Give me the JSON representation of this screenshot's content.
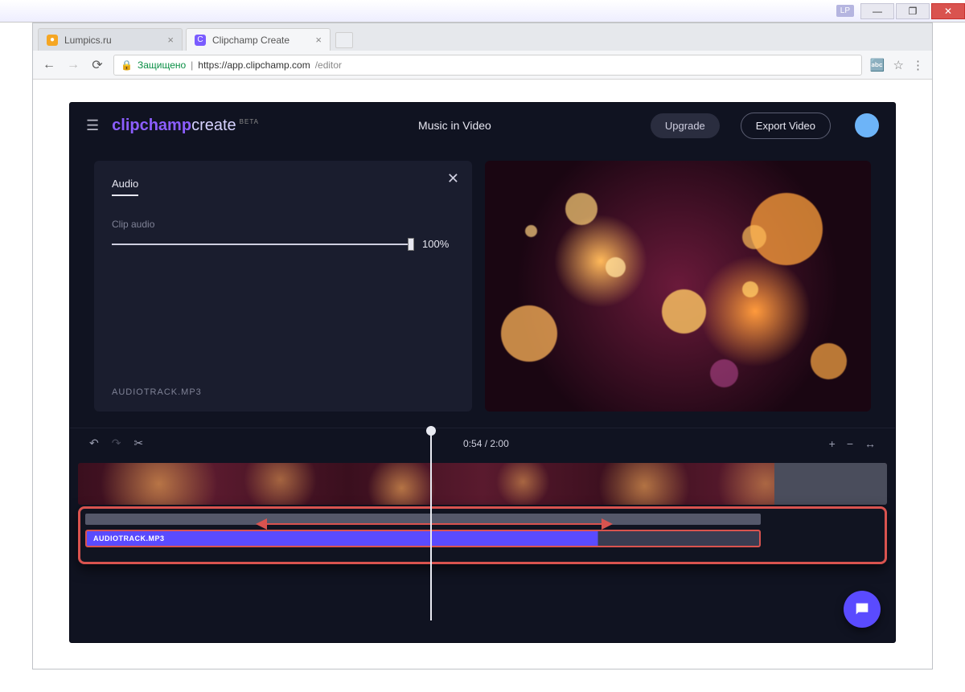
{
  "window": {
    "badge": "LP"
  },
  "browser": {
    "tabs": [
      {
        "title": "Lumpics.ru"
      },
      {
        "title": "Clipchamp Create"
      }
    ],
    "secure_label": "Защищено",
    "url_host": "https://app.clipchamp.com",
    "url_path": "/editor"
  },
  "app": {
    "logo_a": "clipchamp",
    "logo_b": "create",
    "logo_badge": "BETA",
    "project_title": "Music in Video",
    "upgrade_label": "Upgrade",
    "export_label": "Export Video"
  },
  "panel": {
    "tab_label": "Audio",
    "clip_audio_label": "Clip audio",
    "volume_value": "100%",
    "track_filename": "AUDIOTRACK.MP3"
  },
  "timeline": {
    "time_display": "0:54 / 2:00",
    "audio_clip_label": "AUDIOTRACK.MP3"
  }
}
